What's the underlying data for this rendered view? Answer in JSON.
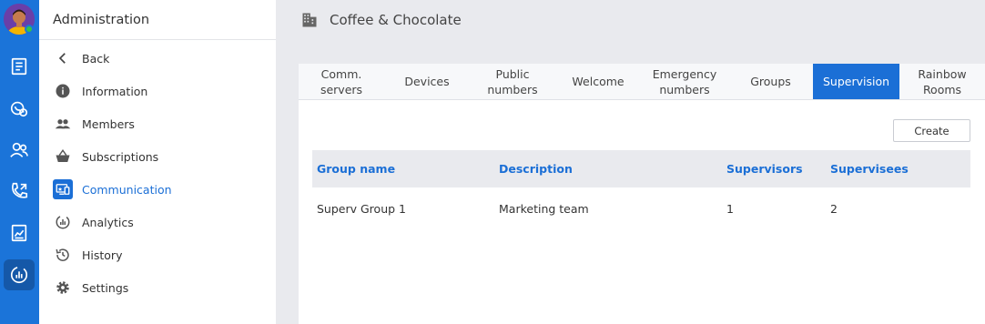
{
  "rail": {
    "items": [
      {
        "icon": "news-icon"
      },
      {
        "icon": "call-settings-icon"
      },
      {
        "icon": "contacts-icon"
      },
      {
        "icon": "phone-icon"
      },
      {
        "icon": "report-icon"
      },
      {
        "icon": "analytics-admin-icon",
        "active": true
      }
    ]
  },
  "panel": {
    "title": "Administration",
    "items": [
      {
        "label": "Back",
        "icon": "chevron-left-icon"
      },
      {
        "label": "Information",
        "icon": "info-icon"
      },
      {
        "label": "Members",
        "icon": "members-icon"
      },
      {
        "label": "Subscriptions",
        "icon": "basket-icon"
      },
      {
        "label": "Communication",
        "icon": "communication-icon",
        "active": true
      },
      {
        "label": "Analytics",
        "icon": "analytics-icon"
      },
      {
        "label": "History",
        "icon": "history-icon"
      },
      {
        "label": "Settings",
        "icon": "gear-icon"
      }
    ]
  },
  "header": {
    "title": "Coffee & Chocolate",
    "icon": "building-icon"
  },
  "tabs": [
    {
      "label": "Comm.\nservers"
    },
    {
      "label": "Devices"
    },
    {
      "label": "Public\nnumbers"
    },
    {
      "label": "Welcome"
    },
    {
      "label": "Emergency\nnumbers"
    },
    {
      "label": "Groups"
    },
    {
      "label": "Supervision",
      "active": true
    },
    {
      "label": "Rainbow\nRooms"
    }
  ],
  "create_label": "Create",
  "table": {
    "columns": [
      "Group name",
      "Description",
      "Supervisors",
      "Supervisees"
    ],
    "rows": [
      [
        "Superv Group 1",
        "Marketing team",
        "1",
        "2"
      ]
    ]
  },
  "colors": {
    "accent": "#1b6fd6",
    "rail": "#1b74d9",
    "presence": "#34c34a"
  }
}
